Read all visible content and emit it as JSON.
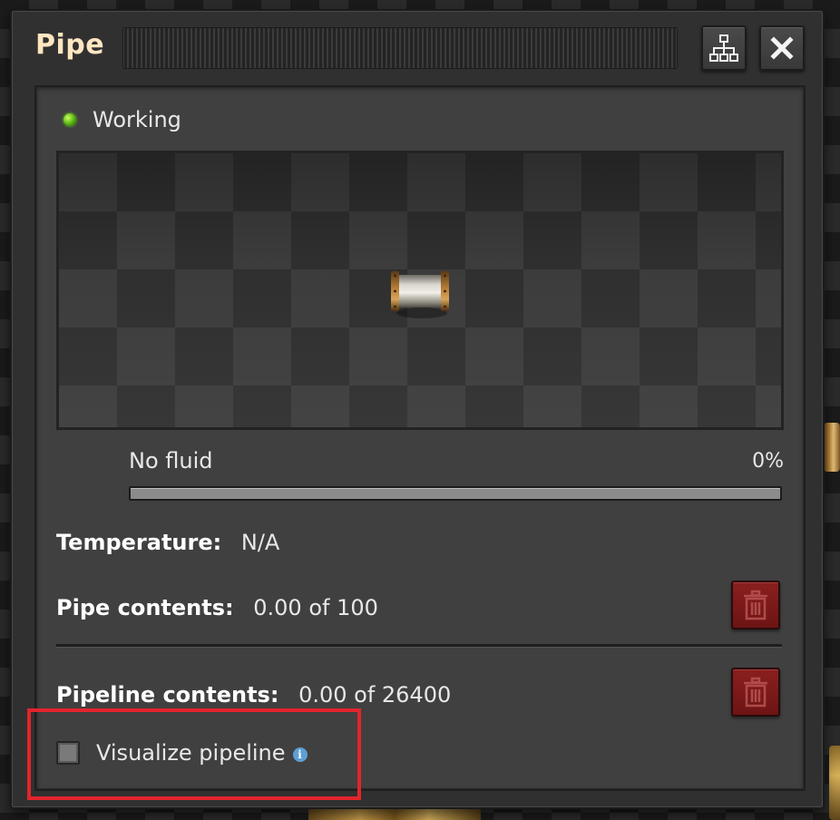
{
  "window": {
    "title": "Pipe",
    "buttons": [
      {
        "name": "tech-tree",
        "icon": "hierarchy-icon"
      },
      {
        "name": "close",
        "icon": "close-icon"
      }
    ]
  },
  "status": {
    "text": "Working",
    "color": "#5bc41a"
  },
  "preview": {
    "entity": "pipe"
  },
  "fluid": {
    "label": "No fluid",
    "percent_text": "0%",
    "fill_fraction": 0.0
  },
  "properties": {
    "temperature": {
      "label": "Temperature:",
      "value": "N/A"
    },
    "pipe_contents": {
      "label": "Pipe contents:",
      "value": "0.00 of 100"
    },
    "pipeline_contents": {
      "label": "Pipeline contents:",
      "value": "0.00 of 26400"
    }
  },
  "actions": {
    "flush_icon": "trash-icon",
    "flush_color": "#7d1a1a"
  },
  "visualize": {
    "label": "Visualize pipeline",
    "checked": false,
    "info_icon": "info-icon"
  },
  "highlight": {
    "color": "#e3242b"
  }
}
